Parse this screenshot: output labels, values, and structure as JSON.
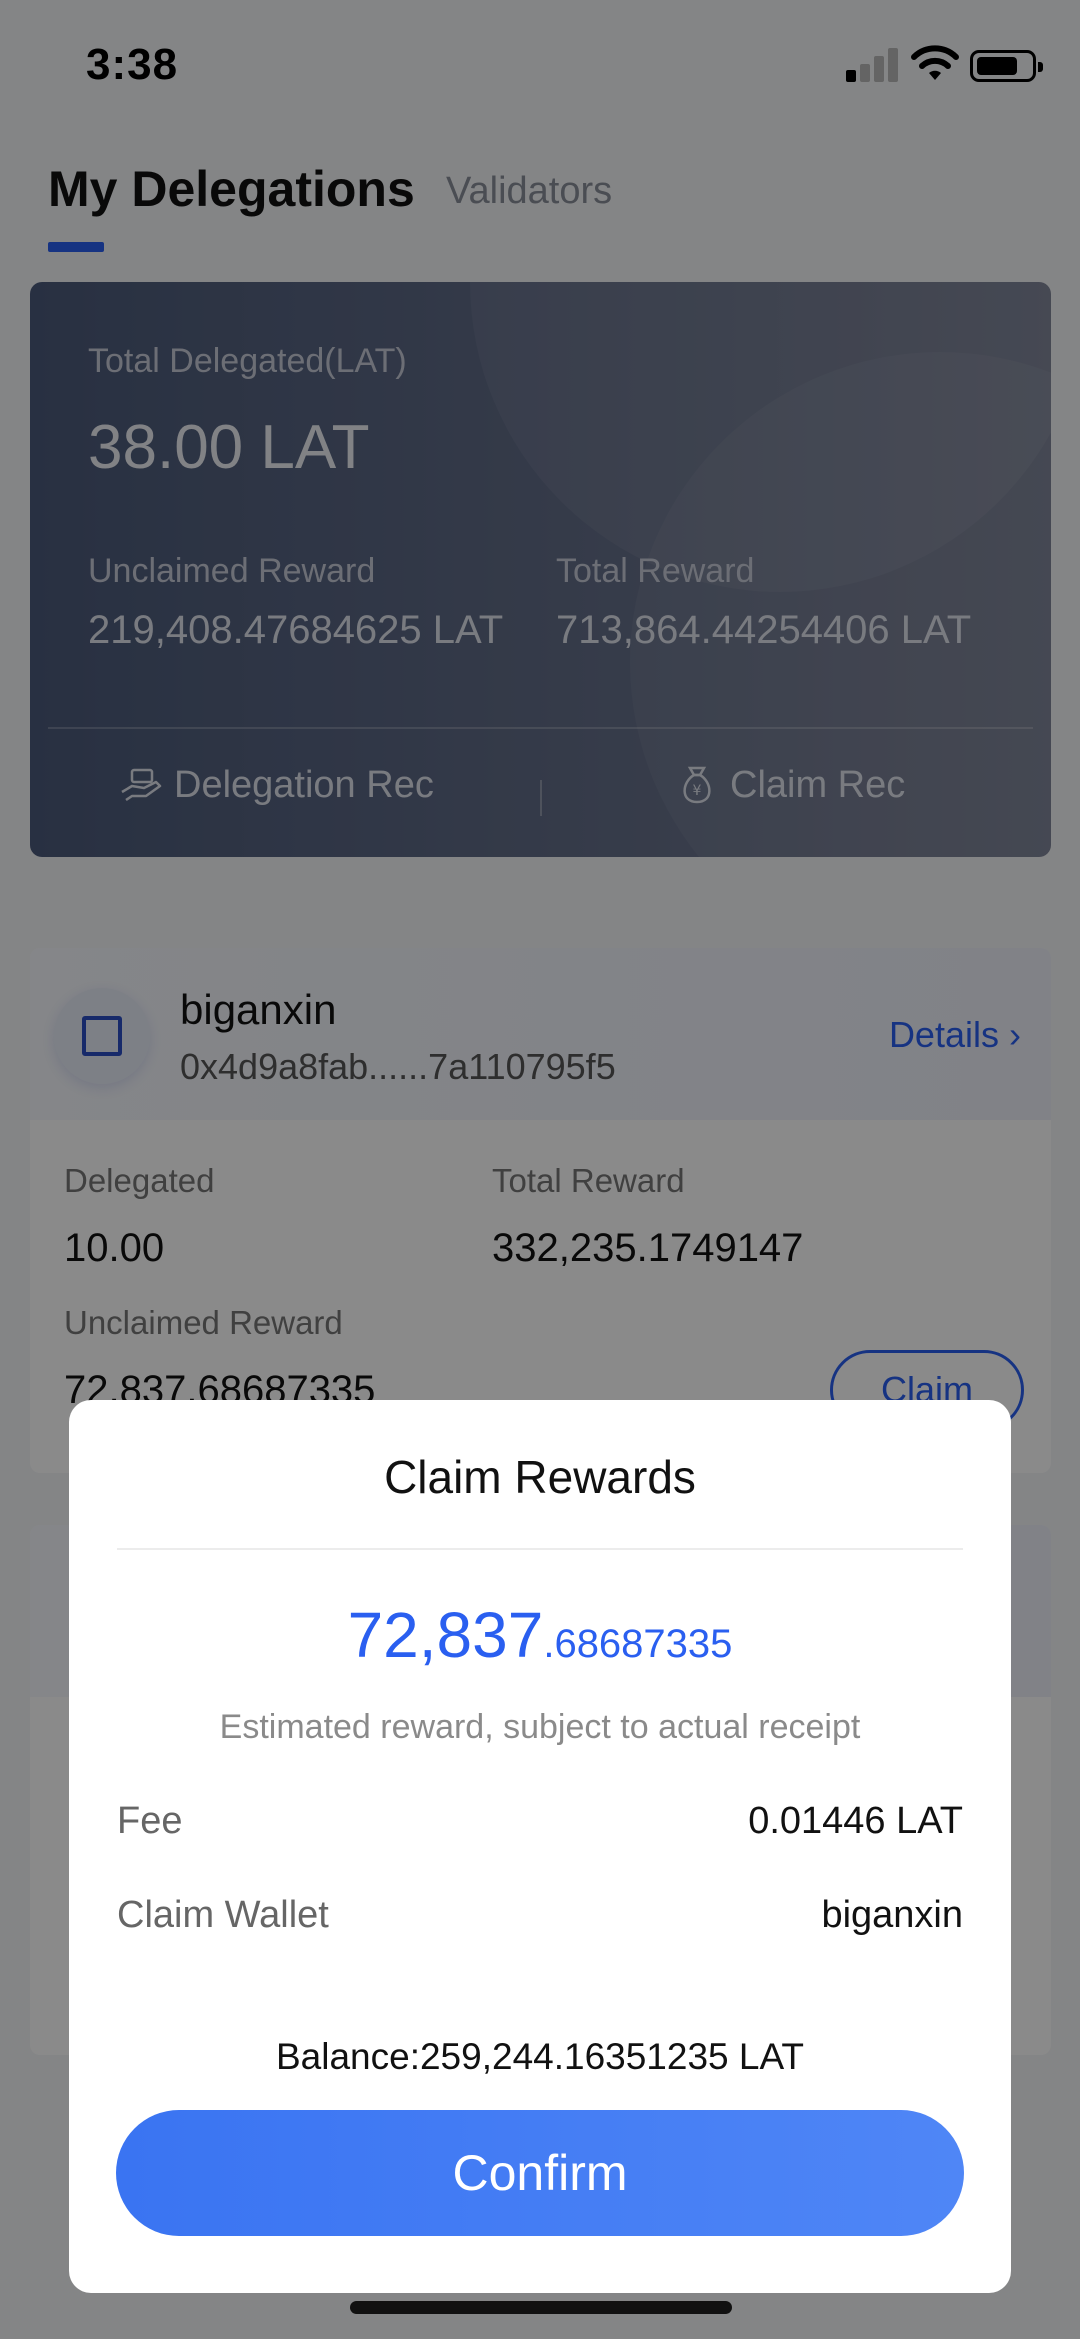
{
  "status_bar": {
    "time": "3:38"
  },
  "tabs": {
    "active": "My Delegations",
    "other": "Validators"
  },
  "summary": {
    "total_delegated_label": "Total Delegated(LAT)",
    "total_delegated_value": "38.00 LAT",
    "unclaimed_label": "Unclaimed Reward",
    "unclaimed_value": "219,408.47684625 LAT",
    "total_reward_label": "Total Reward",
    "total_reward_value": "713,864.44254406 LAT",
    "delegation_rec": "Delegation Rec",
    "claim_rec": "Claim Rec"
  },
  "validator": {
    "name": "biganxin",
    "address": "0x4d9a8fab......7a110795f5",
    "details": "Details",
    "delegated_label": "Delegated",
    "delegated_value": "10.00",
    "total_reward_label": "Total Reward",
    "total_reward_value": "332,235.1749147",
    "unclaimed_label": "Unclaimed Reward",
    "unclaimed_value": "72,837.68687335",
    "claim_button": "Claim"
  },
  "dialog": {
    "title": "Claim Rewards",
    "amount_int": "72,837",
    "amount_dec": ".68687335",
    "note": "Estimated reward, subject to actual receipt",
    "fee_label": "Fee",
    "fee_value": "0.01446 LAT",
    "wallet_label": "Claim Wallet",
    "wallet_value": "biganxin",
    "balance": "Balance:259,244.16351235 LAT",
    "confirm": "Confirm"
  },
  "colors": {
    "accent": "#2a5ff0",
    "confirm": "#3f7bf4"
  }
}
